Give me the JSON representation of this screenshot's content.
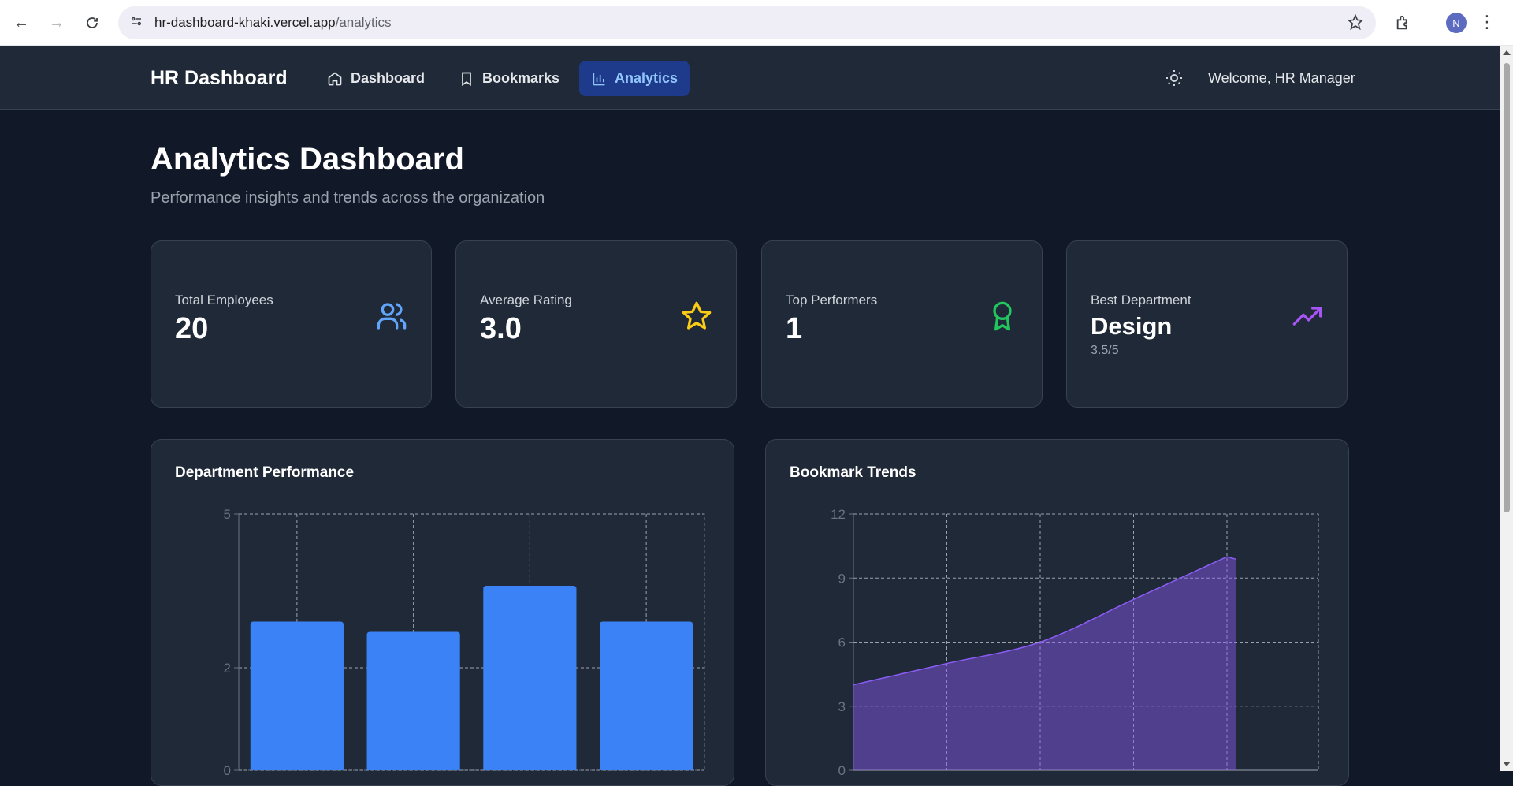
{
  "browser": {
    "url_host": "hr-dashboard-khaki.vercel.app",
    "url_path": "/analytics",
    "avatar_letter": "N"
  },
  "nav": {
    "brand": "HR Dashboard",
    "items": [
      {
        "label": "Dashboard",
        "icon": "home-icon"
      },
      {
        "label": "Bookmarks",
        "icon": "bookmark-icon"
      },
      {
        "label": "Analytics",
        "icon": "bar-chart-icon",
        "active": true
      }
    ],
    "welcome": "Welcome, HR Manager"
  },
  "page": {
    "title": "Analytics Dashboard",
    "subtitle": "Performance insights and trends across the organization"
  },
  "stats": [
    {
      "label": "Total Employees",
      "value": "20",
      "icon": "users-icon",
      "color": "#60a5fa"
    },
    {
      "label": "Average Rating",
      "value": "3.0",
      "icon": "star-icon",
      "color": "#facc15"
    },
    {
      "label": "Top Performers",
      "value": "1",
      "icon": "award-icon",
      "color": "#22c55e"
    },
    {
      "label": "Best Department",
      "value": "Design",
      "sub": "3.5/5",
      "icon": "trending-up-icon",
      "color": "#a855f7"
    }
  ],
  "charts": {
    "department": {
      "title": "Department Performance"
    },
    "bookmarks": {
      "title": "Bookmark Trends"
    }
  },
  "chart_data": [
    {
      "type": "bar",
      "title": "Department Performance",
      "categories": [
        "",
        "",
        "",
        ""
      ],
      "values": [
        2.9,
        2.7,
        3.6,
        2.9
      ],
      "yticks": [
        0,
        2,
        5
      ],
      "ylim": [
        0,
        5
      ],
      "grid": true,
      "color": "#3b82f6"
    },
    {
      "type": "area",
      "title": "Bookmark Trends",
      "x": [
        0,
        1,
        2,
        3,
        4
      ],
      "values": [
        4,
        5,
        6,
        8,
        10
      ],
      "yticks": [
        0,
        3,
        6,
        9,
        12
      ],
      "ylim": [
        0,
        12
      ],
      "grid": true,
      "color": "#8b5cf6"
    }
  ]
}
